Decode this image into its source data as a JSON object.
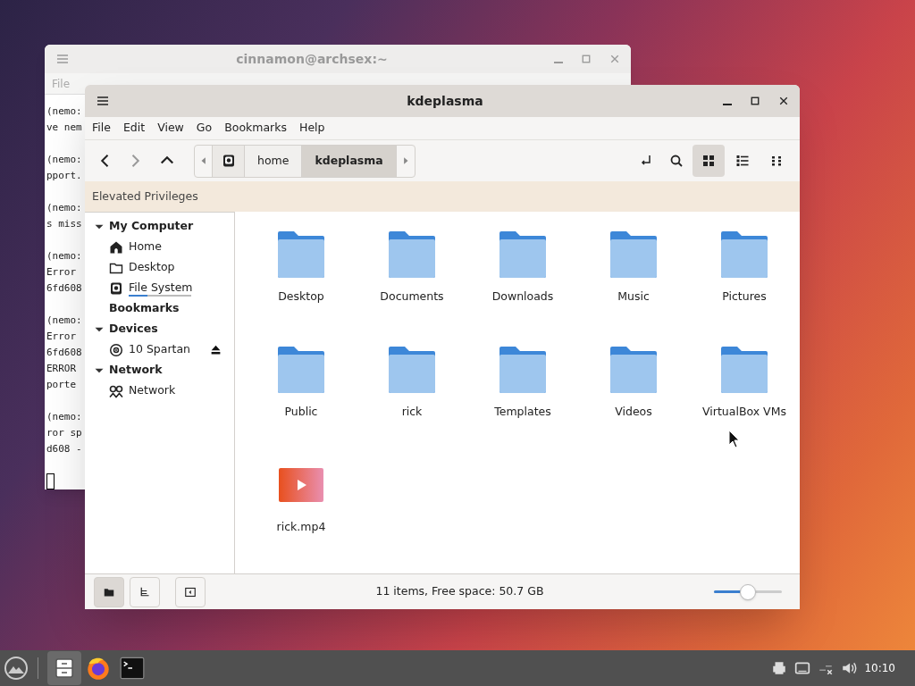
{
  "terminal": {
    "title": "cinnamon@archsex:~",
    "menu": [
      "File"
    ],
    "blocks": [
      [
        "(nemo:",
        "ve nem"
      ],
      [
        "(nemo:",
        "pport."
      ],
      [
        "(nemo:",
        "s miss"
      ],
      [
        "(nemo:",
        "Error",
        "6fd608"
      ],
      [
        "(nemo:",
        "Error",
        "6fd608",
        "ERROR",
        "porte"
      ],
      [
        "(nemo:",
        "ror sp",
        "d608 -"
      ]
    ]
  },
  "file_manager": {
    "title": "kdeplasma",
    "menu": [
      "File",
      "Edit",
      "View",
      "Go",
      "Bookmarks",
      "Help"
    ],
    "breadcrumb": [
      {
        "label": "home",
        "selected": false
      },
      {
        "label": "kdeplasma",
        "selected": true
      }
    ],
    "views": [
      {
        "kind": "icons",
        "selected": true
      },
      {
        "kind": "list",
        "selected": false
      },
      {
        "kind": "compact",
        "selected": false
      }
    ],
    "banner": "Elevated Privileges",
    "sidebar": [
      {
        "label": "My Computer",
        "expanded": true,
        "children": [
          {
            "label": "Home",
            "kind": "home",
            "ejectable": false
          },
          {
            "label": "Desktop",
            "kind": "folder",
            "ejectable": false
          },
          {
            "label": "File System",
            "kind": "drive",
            "ejectable": false,
            "level": 0.3
          }
        ]
      },
      {
        "label": "Bookmarks"
      },
      {
        "label": "Devices",
        "expanded": true,
        "children": [
          {
            "label": "10 Spartan",
            "kind": "disc",
            "ejectable": true
          }
        ]
      },
      {
        "label": "Network",
        "expanded": true,
        "children": [
          {
            "label": "Network",
            "kind": "network",
            "ejectable": false
          }
        ]
      }
    ],
    "files": [
      {
        "name": "Desktop",
        "kind": "folder"
      },
      {
        "name": "Documents",
        "kind": "folder"
      },
      {
        "name": "Downloads",
        "kind": "folder"
      },
      {
        "name": "Music",
        "kind": "folder"
      },
      {
        "name": "Pictures",
        "kind": "folder"
      },
      {
        "name": "Public",
        "kind": "folder"
      },
      {
        "name": "rick",
        "kind": "folder"
      },
      {
        "name": "Templates",
        "kind": "folder"
      },
      {
        "name": "Videos",
        "kind": "folder"
      },
      {
        "name": "VirtualBox VMs",
        "kind": "folder"
      },
      {
        "name": "rick.mp4",
        "kind": "video"
      }
    ],
    "pane_buttons": [
      {
        "kind": "places",
        "selected": true
      },
      {
        "kind": "tree",
        "selected": false
      },
      {
        "kind": "sidebar",
        "selected": false
      }
    ],
    "status": "11 items, Free space: 50.7 GB",
    "zoom": {
      "level": 0.5
    }
  },
  "taskbar": {
    "apps": [
      {
        "kind": "files",
        "selected": true
      },
      {
        "kind": "browser",
        "selected": false
      },
      {
        "kind": "terminal",
        "selected": false
      }
    ],
    "clock": "10:10"
  }
}
